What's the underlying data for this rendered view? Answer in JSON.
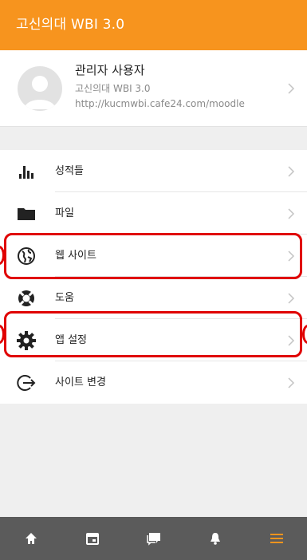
{
  "header": {
    "title": "고신의대 WBI 3.0"
  },
  "profile": {
    "name": "관리자 사용자",
    "site": "고신의대 WBI 3.0",
    "url": "http://kucmwbi.cafe24.com/moodle"
  },
  "menu": {
    "items": [
      {
        "label": "성적들",
        "icon": "grades-bar-chart-icon"
      },
      {
        "label": "파일",
        "icon": "folder-icon"
      },
      {
        "label": "웹 사이트",
        "icon": "globe-icon"
      },
      {
        "label": "도움",
        "icon": "lifebuoy-icon"
      },
      {
        "label": "앱 설정",
        "icon": "gear-icon"
      },
      {
        "label": "사이트 변경",
        "icon": "exit-icon"
      }
    ]
  },
  "tabbar": {
    "items": [
      "home-icon",
      "calendar-icon",
      "messages-icon",
      "notifications-bell-icon",
      "menu-hamburger-icon"
    ],
    "active_index": 4
  },
  "colors": {
    "header": "#f7941e",
    "active_tab": "#f7941e",
    "highlight": "#e00000",
    "tabbar": "#5b5b5b"
  }
}
